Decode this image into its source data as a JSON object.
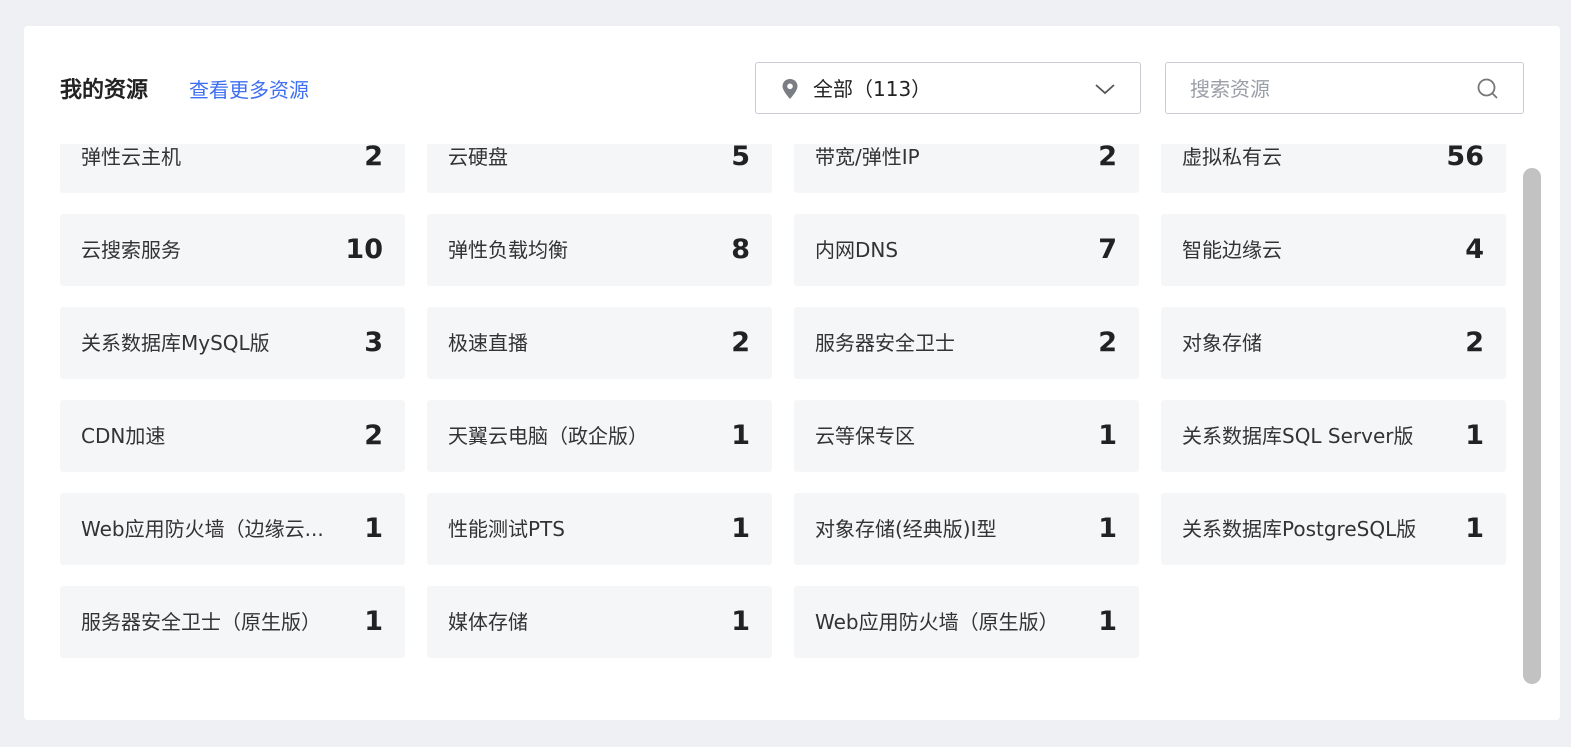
{
  "header": {
    "title": "我的资源",
    "more_link": "查看更多资源"
  },
  "region_select": {
    "value": "全部（113）",
    "icon": "location-pin-icon"
  },
  "search": {
    "placeholder": "搜索资源",
    "value": ""
  },
  "resources": [
    {
      "name": "弹性云主机",
      "count": "2"
    },
    {
      "name": "云硬盘",
      "count": "5"
    },
    {
      "name": "带宽/弹性IP",
      "count": "2"
    },
    {
      "name": "虚拟私有云",
      "count": "56"
    },
    {
      "name": "云搜索服务",
      "count": "10"
    },
    {
      "name": "弹性负载均衡",
      "count": "8"
    },
    {
      "name": "内网DNS",
      "count": "7"
    },
    {
      "name": "智能边缘云",
      "count": "4"
    },
    {
      "name": "关系数据库MySQL版",
      "count": "3"
    },
    {
      "name": "极速直播",
      "count": "2"
    },
    {
      "name": "服务器安全卫士",
      "count": "2"
    },
    {
      "name": "对象存储",
      "count": "2"
    },
    {
      "name": "CDN加速",
      "count": "2"
    },
    {
      "name": "天翼云电脑（政企版）",
      "count": "1"
    },
    {
      "name": "云等保专区",
      "count": "1"
    },
    {
      "name": "关系数据库SQL Server版",
      "count": "1"
    },
    {
      "name": "Web应用防火墙（边缘云...",
      "count": "1"
    },
    {
      "name": "性能测试PTS",
      "count": "1"
    },
    {
      "name": "对象存储(经典版)I型",
      "count": "1"
    },
    {
      "name": "关系数据库PostgreSQL版",
      "count": "1"
    },
    {
      "name": "服务器安全卫士（原生版）",
      "count": "1"
    },
    {
      "name": "媒体存储",
      "count": "1"
    },
    {
      "name": "Web应用防火墙（原生版）",
      "count": "1"
    }
  ]
}
